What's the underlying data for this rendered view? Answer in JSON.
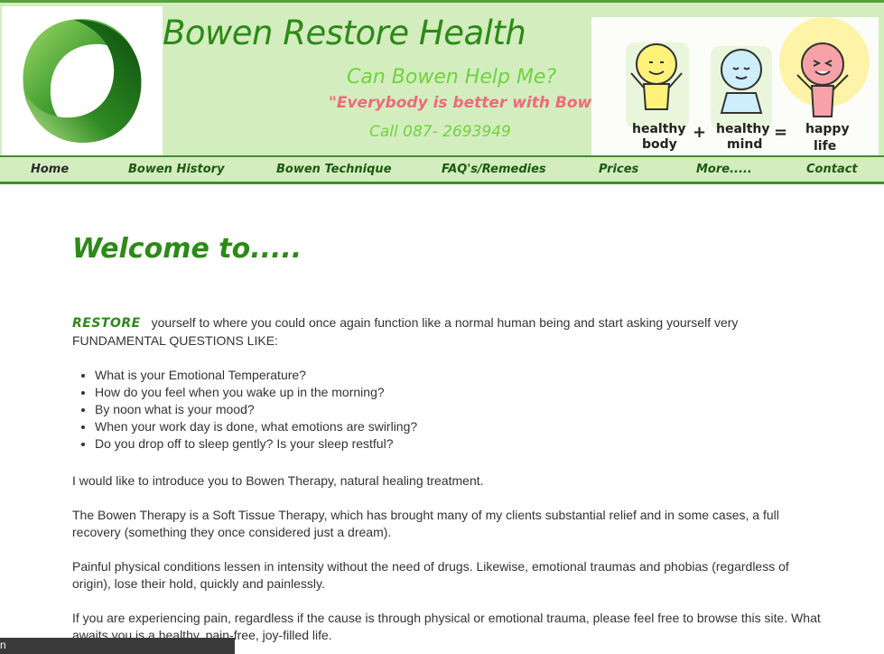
{
  "header": {
    "title": "Bowen Restore Health",
    "tagline_question": "Can Bowen Help Me?",
    "tagline_quote": "\"Everybody is better with Bowen\"",
    "phone": "Call 087- 2693949",
    "hero_image": {
      "words": [
        "healthy",
        "body",
        "+",
        "healthy",
        "mind",
        "=",
        "happy",
        "life"
      ]
    }
  },
  "nav": {
    "items": [
      {
        "label": "Home"
      },
      {
        "label": "Bowen History"
      },
      {
        "label": "Bowen Technique"
      },
      {
        "label": "FAQ's/Remedies"
      },
      {
        "label": "Prices"
      },
      {
        "label": "More....."
      },
      {
        "label": "Contact"
      }
    ]
  },
  "main": {
    "heading": "Welcome to.....",
    "intro_keyword": "RESTORE",
    "intro_text": "yourself to where you could once again function like a normal human being and start asking yourself very FUNDAMENTAL QUESTIONS LIKE:",
    "questions": [
      "What is your Emotional Temperature?",
      "How do you feel when you wake up in the morning?",
      "By noon what is your mood?",
      "When your work day is done, what emotions are swirling?",
      "Do you drop off to sleep gently? Is your sleep restful?"
    ],
    "paragraphs": [
      "I would like to introduce you to Bowen Therapy, natural healing treatment.",
      "The Bowen Therapy is a Soft Tissue Therapy, which  has brought many of my clients substantial relief and in some cases, a full recovery (something they once considered just a dream).",
      "Painful physical conditions lessen in intensity without the need of drugs. Likewise, emotional traumas and phobias (regardless of origin), lose their hold, quickly and painlessly.",
      "If you are experiencing pain, regardless if the cause is through physical or emotional trauma, please feel free to browse this site. What awaits you is a healthy, pain-free, joy-filled life."
    ]
  },
  "bottom_bar": {
    "text": "n"
  },
  "colors": {
    "brand_green": "#2c8a17",
    "light_green": "#6fd33e",
    "header_bg": "#d3edbf",
    "quote_pink": "#ef6a78",
    "nav_border": "#3f8f2b"
  }
}
